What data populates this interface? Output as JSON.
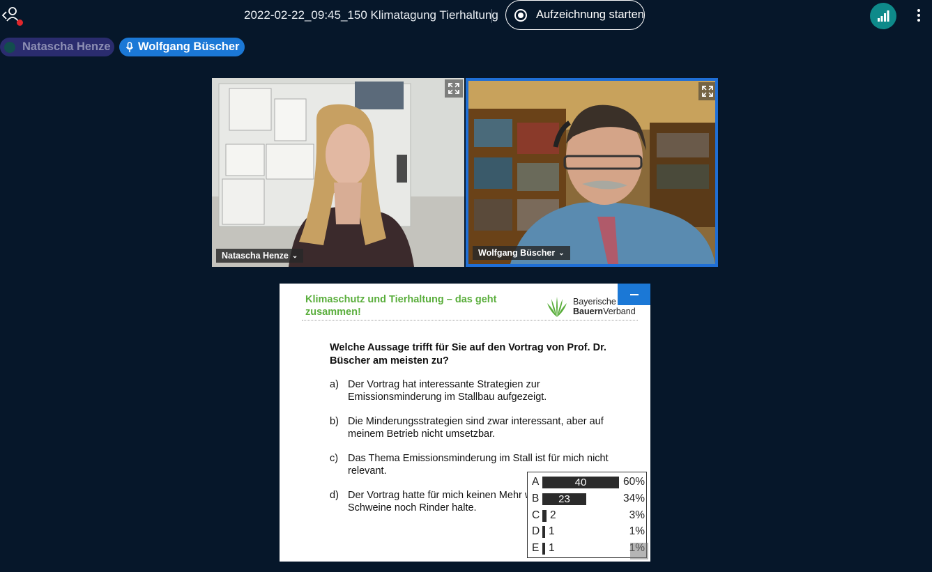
{
  "header": {
    "meeting_title": "2022-02-22_09:45_150 Klimatagung Tierhaltung",
    "record_label": "Aufzeichnung starten",
    "icons": [
      "user-menu-icon",
      "record-icon",
      "connection-status-icon",
      "more-options-icon"
    ]
  },
  "talking_indicators": [
    {
      "name": "Natascha Henze",
      "active": false
    },
    {
      "name": "Wolfgang Büscher",
      "active": true
    }
  ],
  "videos": [
    {
      "name": "Natascha Henze"
    },
    {
      "name": "Wolfgang Büscher"
    }
  ],
  "presentation": {
    "title": "Klimaschutz und Tierhaltung – das geht zusammen!",
    "logo_line1": "Bayerische",
    "logo_line2_bold": "Bauern",
    "logo_line2_rest": "Verband",
    "question": "Welche Aussage trifft für Sie auf den Vortrag von Prof. Dr. Büscher am meisten zu?",
    "options": [
      {
        "letter": "a)",
        "text": "Der Vortrag hat interessante Strategien zur Emissionsminderung im Stallbau aufgezeigt."
      },
      {
        "letter": "b)",
        "text": "Die Minderungsstrategien sind zwar interessant, aber auf meinem Betrieb nicht umsetzbar."
      },
      {
        "letter": "c)",
        "text": "Das Thema Emissionsminderung im Stall ist für mich nicht relevant."
      },
      {
        "letter": "d)",
        "text": "Der Vortrag hatte für mich keinen Mehr weder Schweine noch Rinder halte."
      }
    ],
    "poll": [
      {
        "option": "A",
        "count": 40,
        "count_label": "40",
        "percent": "60%"
      },
      {
        "option": "B",
        "count": 23,
        "count_label": "23",
        "percent": "34%"
      },
      {
        "option": "C",
        "count": 2,
        "count_label": "2",
        "percent": "3%"
      },
      {
        "option": "D",
        "count": 1,
        "count_label": "1",
        "percent": "1%"
      },
      {
        "option": "E",
        "count": 1,
        "count_label": "1",
        "percent": "1%"
      }
    ]
  },
  "colors": {
    "background": "#06172a",
    "accent": "#1b78d6",
    "connection": "#0e8a8a",
    "slide_title_green": "#5aae3c",
    "notification": "#e0262b"
  }
}
